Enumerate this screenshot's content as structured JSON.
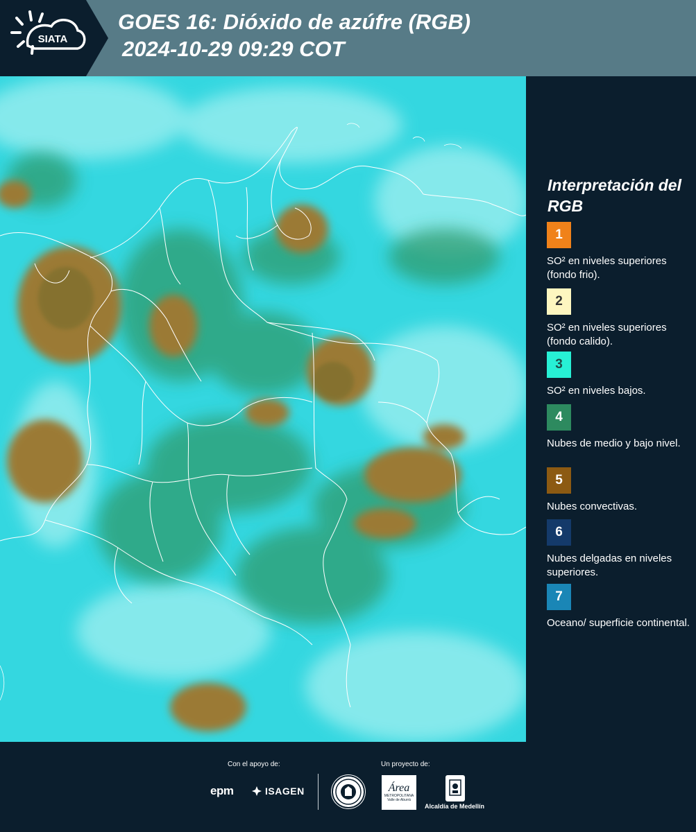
{
  "header": {
    "logo_text": "SIATA",
    "title_line1": "GOES 16: Dióxido de azúfre (RGB)",
    "title_line2": "2024-10-29 09:29 COT",
    "background": "#577b87"
  },
  "map": {
    "base_color": "#34d7e0",
    "boundary_color": "#ffffff",
    "colors": {
      "ocean_surface": "#34d7e0",
      "light_surface": "#a9f2f3",
      "mid_low_clouds": "#2f9b6e",
      "convective": "#9b7a36"
    }
  },
  "legend": {
    "title": "Interpretación del RGB",
    "items": [
      {
        "number": "1",
        "color": "#f0821a",
        "text": "SO² en niveles superiores (fondo frio)."
      },
      {
        "number": "2",
        "color": "#fdf6c0",
        "text": "SO² en niveles superiores (fondo calido)."
      },
      {
        "number": "3",
        "color": "#27f0d5",
        "text": "SO² en niveles bajos."
      },
      {
        "number": "4",
        "color": "#2d8a5f",
        "text": "Nubes de medio y bajo nivel."
      },
      {
        "number": "5",
        "color": "#8c5a12",
        "text": "Nubes convectivas."
      },
      {
        "number": "6",
        "color": "#143a6a",
        "text": "Nubes delgadas en niveles superiores."
      },
      {
        "number": "7",
        "color": "#1a86b6",
        "text": "Oceano/ superficie continental."
      }
    ]
  },
  "footer": {
    "support_label": "Con el apoyo de:",
    "project_label": "Un proyecto de:",
    "sponsor1": "epm",
    "sponsor2": "ISAGEN",
    "area_logo_word": "Área",
    "area_logo_sub": "METROPOLITANA Valle de Aburrá",
    "alcaldia_label": "Alcaldía de Medellín"
  }
}
